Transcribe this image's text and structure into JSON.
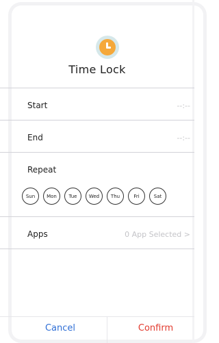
{
  "dialog": {
    "title": "Time Lock",
    "icon": "clock-icon",
    "start": {
      "label": "Start",
      "value": "--:--"
    },
    "end": {
      "label": "End",
      "value": "--:--"
    },
    "repeat": {
      "label": "Repeat",
      "days": [
        "Sun",
        "Mon",
        "Tue",
        "Wed",
        "Thu",
        "Fri",
        "Sat"
      ]
    },
    "apps": {
      "label": "Apps",
      "value": "0 App Selected >"
    },
    "buttons": {
      "cancel": "Cancel",
      "confirm": "Confirm"
    }
  },
  "colors": {
    "icon_bg": "#d6e8ea",
    "icon_fill": "#f5a83a",
    "cancel": "#2f6fd6",
    "confirm": "#e23a2e",
    "placeholder": "#c4c4c8",
    "divider": "#d2d2d8"
  }
}
